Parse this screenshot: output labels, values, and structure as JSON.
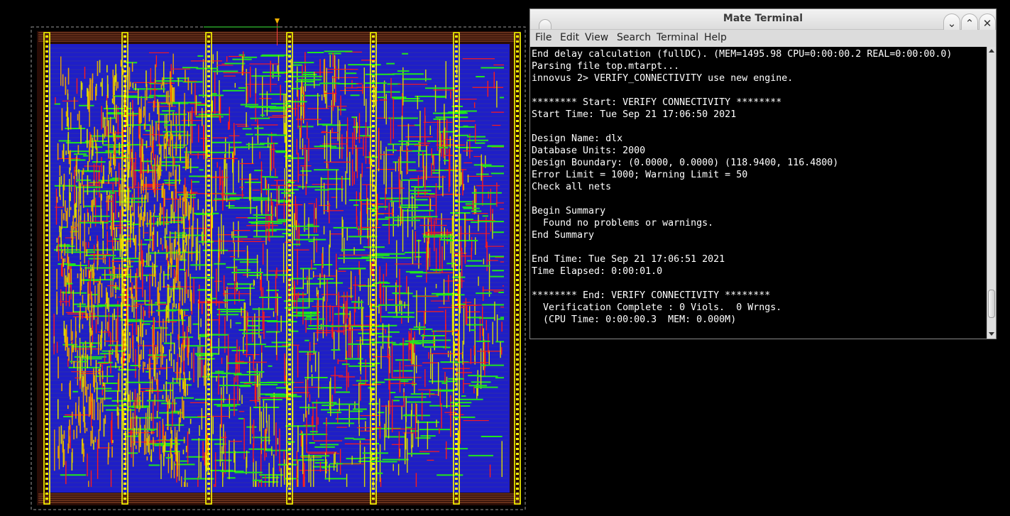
{
  "layout_view": {
    "colors": {
      "background": "#000000",
      "core_fill": "#1e1ec8",
      "power_rail": "#ffff00",
      "metal_red": "#ff1a1a",
      "metal_green": "#1ee61e",
      "metal_yellow": "#d8d800",
      "metal_orange": "#e8a000",
      "ring_brown": "#a0522d",
      "boundary": "#9a9a9a"
    }
  },
  "terminal": {
    "title": "Mate Terminal",
    "menu": {
      "file": "File",
      "edit": "Edit",
      "view": "View",
      "search": "Search",
      "terminal": "Terminal",
      "help": "Help"
    },
    "lines": [
      "End delay calculation (fullDC). (MEM=1495.98 CPU=0:00:00.2 REAL=0:00:00.0)",
      "Parsing file top.mtarpt...",
      "innovus 2> VERIFY_CONNECTIVITY use new engine.",
      "",
      "******** Start: VERIFY CONNECTIVITY ********",
      "Start Time: Tue Sep 21 17:06:50 2021",
      "",
      "Design Name: dlx",
      "Database Units: 2000",
      "Design Boundary: (0.0000, 0.0000) (118.9400, 116.4800)",
      "Error Limit = 1000; Warning Limit = 50",
      "Check all nets",
      "",
      "Begin Summary",
      "  Found no problems or warnings.",
      "End Summary",
      "",
      "End Time: Tue Sep 21 17:06:51 2021",
      "Time Elapsed: 0:00:01.0",
      "",
      "******** End: VERIFY CONNECTIVITY ********",
      "  Verification Complete : 0 Viols.  0 Wrngs.",
      "  (CPU Time: 0:00:00.3  MEM: 0.000M)"
    ],
    "icons": {
      "minimize": "chevron-down-icon",
      "maximize": "chevron-up-icon",
      "close": "close-icon"
    }
  }
}
